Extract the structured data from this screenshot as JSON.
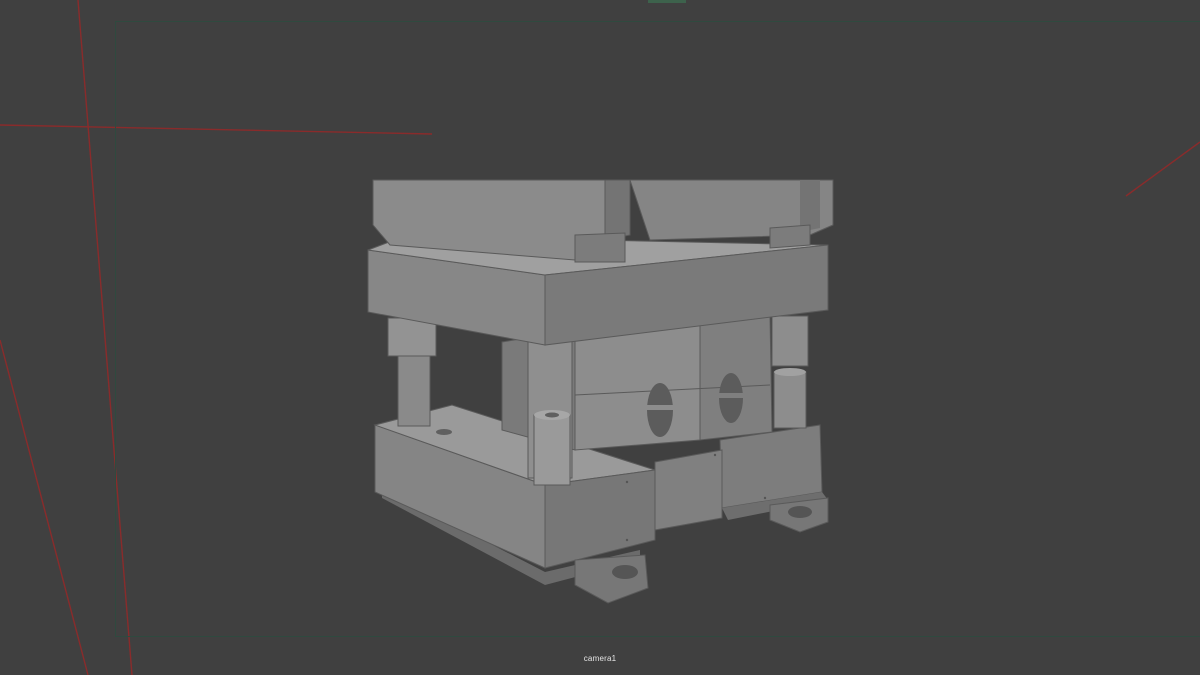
{
  "viewport": {
    "camera_name": "camera1",
    "background_color": "#404040",
    "grid_line_color": "#8a2b2b",
    "gate_color": "#2f4a3f",
    "model_color": "#8a8a8a",
    "object": "die-set-model"
  }
}
